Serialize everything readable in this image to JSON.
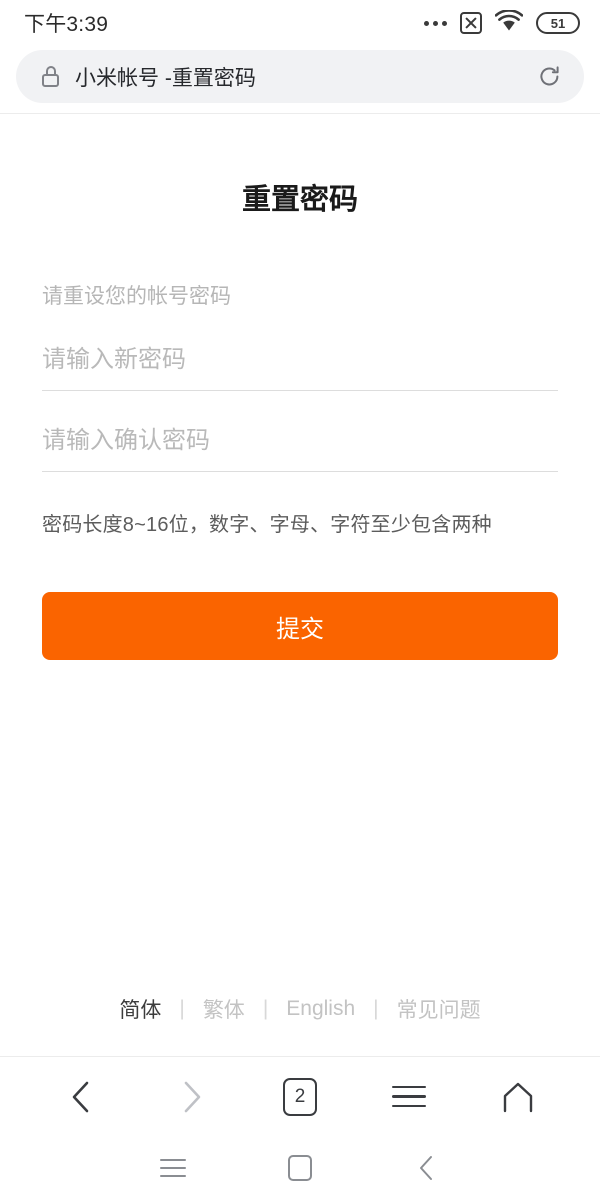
{
  "status_bar": {
    "time": "下午3:39",
    "dots_icon": "more-dots-icon",
    "sim_icon": "no-sim-icon",
    "wifi_icon": "wifi-icon",
    "battery_level": "51"
  },
  "browser": {
    "lock_icon": "lock-icon",
    "url_text": "小米帐号 -重置密码",
    "reload_icon": "reload-icon",
    "toolbar": {
      "back_label": "back-icon",
      "forward_label": "forward-icon",
      "tab_count": "2",
      "menu_label": "menu-icon",
      "home_label": "home-icon"
    }
  },
  "page": {
    "title": "重置密码",
    "subtitle": "请重设您的帐号密码",
    "fields": [
      {
        "name": "new-password",
        "value": "",
        "placeholder": "请输入新密码"
      },
      {
        "name": "confirm-password",
        "value": "",
        "placeholder": "请输入确认密码"
      }
    ],
    "hint": "密码长度8~16位，数字、字母、字符至少包含两种",
    "submit_label": "提交",
    "footer": {
      "links": [
        {
          "label": "简体",
          "active": true
        },
        {
          "label": "繁体",
          "active": false
        },
        {
          "label": "English",
          "active": false
        },
        {
          "label": "常见问题",
          "active": false
        }
      ],
      "separator": "|"
    }
  },
  "android_nav": {
    "recents_icon": "recents-icon",
    "home_icon": "home-square-icon",
    "back_icon": "back-chevron-icon"
  },
  "colors": {
    "accent": "#fa6400",
    "url_bar_bg": "#f1f2f4",
    "placeholder": "#b9b9b9"
  }
}
